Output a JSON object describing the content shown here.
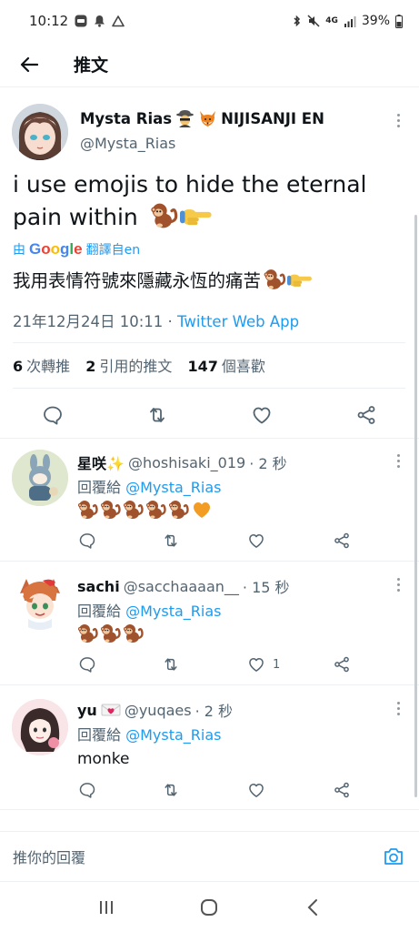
{
  "status_bar": {
    "time": "10:12",
    "battery": "39%",
    "network": "4G"
  },
  "header": {
    "title": "推文"
  },
  "main_tweet": {
    "name": "Mysta Rias",
    "name_suffix": "NIJISANJI EN",
    "handle": "@Mysta_Rias",
    "text": "i use emojis to hide the eternal pain within",
    "translate_prefix": "由",
    "translate_brand": "Google",
    "translate_suffix": "翻譯自en",
    "translated_text": "我用表情符號來隱藏永恆的痛苦",
    "timestamp": "21年12月24日 10:11",
    "separator": "·",
    "source": "Twitter Web App",
    "stats": {
      "retweets_count": "6",
      "retweets_label": "次轉推",
      "quotes_count": "2",
      "quotes_label": "引用的推文",
      "likes_count": "147",
      "likes_label": "個喜歡"
    }
  },
  "replies": [
    {
      "name": "星咲✨",
      "handle": "@hoshisaki_019",
      "time": "· 2 秒",
      "reply_prefix": "回覆給",
      "reply_to": "@Mysta_Rias",
      "body": "",
      "like_count": ""
    },
    {
      "name": "sachi",
      "handle": "@sacchaaaan__",
      "time": "· 15 秒",
      "reply_prefix": "回覆給",
      "reply_to": "@Mysta_Rias",
      "body": "",
      "like_count": "1"
    },
    {
      "name": "yu",
      "handle": "@yuqaes",
      "time": "· 2 秒",
      "reply_prefix": "回覆給",
      "reply_to": "@Mysta_Rias",
      "body": "monke",
      "like_count": ""
    }
  ],
  "reply_bar": {
    "placeholder": "推你的回覆"
  },
  "colors": {
    "accent": "#1d9bf0",
    "secondary_text": "#536471",
    "divider": "#eef1f3",
    "monkey": "#a0522d"
  },
  "icons": [
    "back-arrow-icon",
    "reply-icon",
    "retweet-icon",
    "like-icon",
    "share-icon",
    "camera-icon",
    "monkey-emoji",
    "pointing-hand-emoji",
    "orange-heart-emoji"
  ]
}
